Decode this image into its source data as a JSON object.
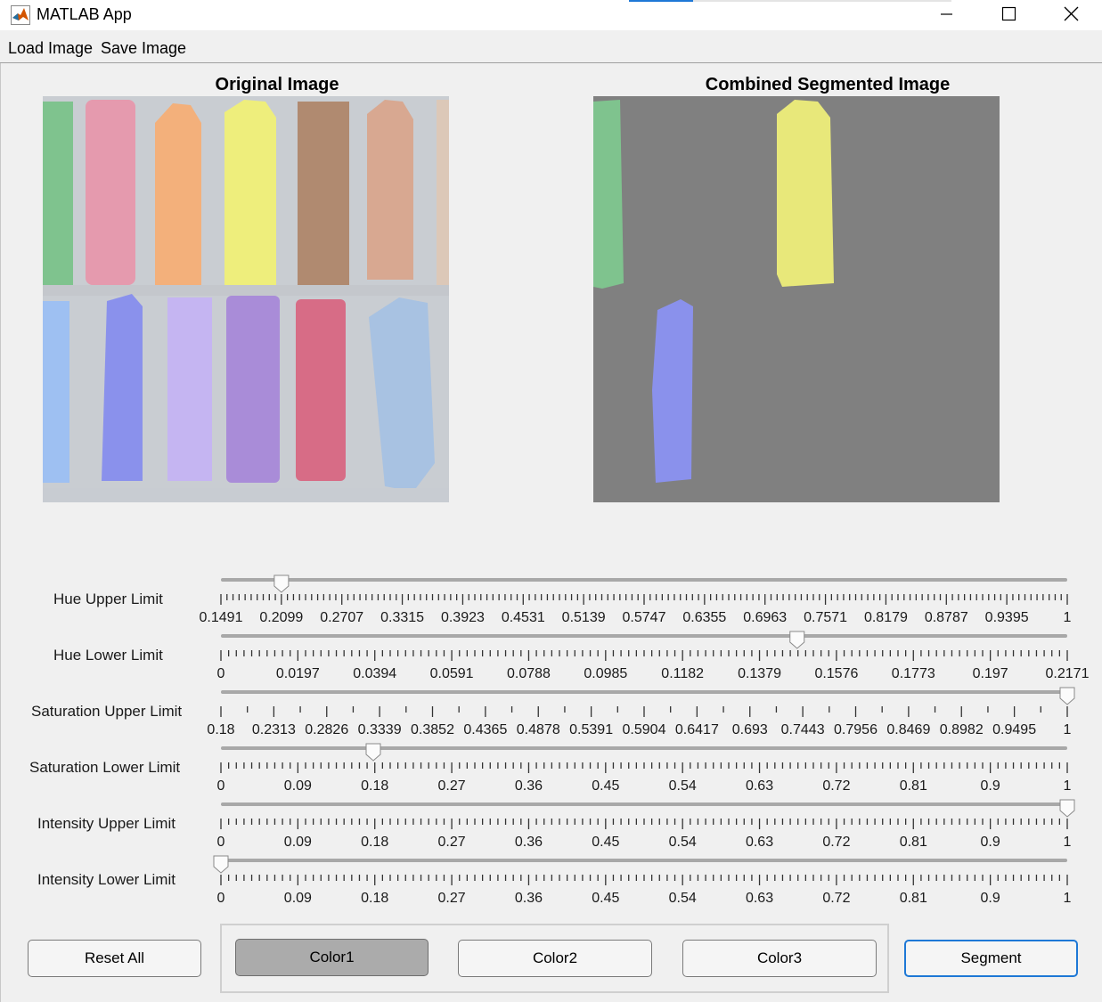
{
  "window": {
    "title": "MATLAB App"
  },
  "menu": {
    "load_label": "Load Image",
    "save_label": "Save Image"
  },
  "panels": {
    "original_title": "Original Image",
    "segmented_title": "Combined Segmented Image"
  },
  "sliders": [
    {
      "label": "Hue Upper Limit",
      "min": 0.1491,
      "max": 1,
      "value": 0.2099,
      "ticks": [
        "0.1491",
        "0.2099",
        "0.2707",
        "0.3315",
        "0.3923",
        "0.4531",
        "0.5139",
        "0.5747",
        "0.6355",
        "0.6963",
        "0.7571",
        "0.8179",
        "0.8787",
        "0.9395",
        "1"
      ]
    },
    {
      "label": "Hue Lower Limit",
      "min": 0,
      "max": 0.2171,
      "value": 0.1478,
      "ticks": [
        "0",
        "0.0197",
        "0.0394",
        "0.0591",
        "0.0788",
        "0.0985",
        "0.1182",
        "0.1379",
        "0.1576",
        "0.1773",
        "0.197",
        "0.2171"
      ]
    },
    {
      "label": "Saturation Upper Limit",
      "min": 0.18,
      "max": 1,
      "value": 1,
      "ticks": [
        "0.18",
        "0.2313",
        "0.2826",
        "0.3339",
        "0.3852",
        "0.4365",
        "0.4878",
        "0.5391",
        "0.5904",
        "0.6417",
        "0.693",
        "0.7443",
        "0.7956",
        "0.8469",
        "0.8982",
        "0.9495",
        "1"
      ]
    },
    {
      "label": "Saturation Lower Limit",
      "min": 0,
      "max": 1,
      "value": 0.18,
      "ticks": [
        "0",
        "0.09",
        "0.18",
        "0.27",
        "0.36",
        "0.45",
        "0.54",
        "0.63",
        "0.72",
        "0.81",
        "0.9",
        "1"
      ]
    },
    {
      "label": "Intensity Upper Limit",
      "min": 0,
      "max": 1,
      "value": 1,
      "ticks": [
        "0",
        "0.09",
        "0.18",
        "0.27",
        "0.36",
        "0.45",
        "0.54",
        "0.63",
        "0.72",
        "0.81",
        "0.9",
        "1"
      ]
    },
    {
      "label": "Intensity Lower Limit",
      "min": 0,
      "max": 1,
      "value": 0,
      "ticks": [
        "0",
        "0.09",
        "0.18",
        "0.27",
        "0.36",
        "0.45",
        "0.54",
        "0.63",
        "0.72",
        "0.81",
        "0.9",
        "1"
      ]
    }
  ],
  "buttons": {
    "reset": "Reset All",
    "color1": "Color1",
    "color2": "Color2",
    "color3": "Color3",
    "segment": "Segment"
  },
  "colors": {
    "accent": "#1e78d6",
    "pressed": "#ababab",
    "segment_background": "#808080"
  }
}
